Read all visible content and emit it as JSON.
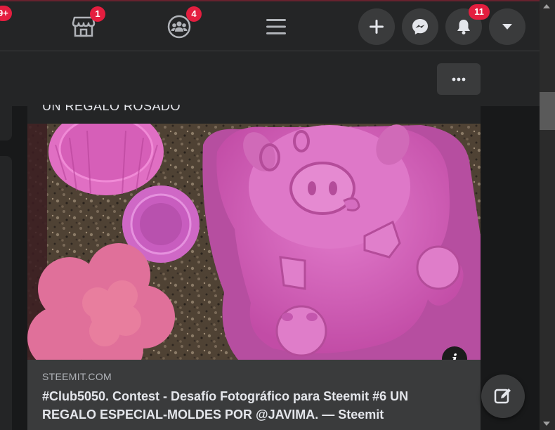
{
  "topbar": {
    "left_badge": "9+",
    "marketplace_badge": "1",
    "groups_badge": "4",
    "notifications_badge": "11"
  },
  "icons": {
    "marketplace": "marketplace-icon",
    "groups": "groups-icon",
    "menu": "hamburger-menu-icon",
    "create": "plus-icon",
    "messenger": "messenger-icon",
    "notifications": "bell-icon",
    "account": "caret-down-icon",
    "more": "more-dots-icon",
    "info": "info-icon",
    "compose": "compose-icon"
  },
  "post": {
    "cut_text": "UN REGALO ROSADO",
    "link_domain": "STEEMIT.COM",
    "link_title": "#Club5050. Contest - Desafío Fotográfico para Steemit #6 UN REGALO ESPECIAL-MOLDES POR @JAVIMA. — Steemit",
    "info_symbol": "i"
  },
  "colors": {
    "background": "#18191a",
    "surface": "#242526",
    "button": "#3a3b3c",
    "badge": "#e41e3f",
    "mold_pink": "#d65fb8"
  }
}
